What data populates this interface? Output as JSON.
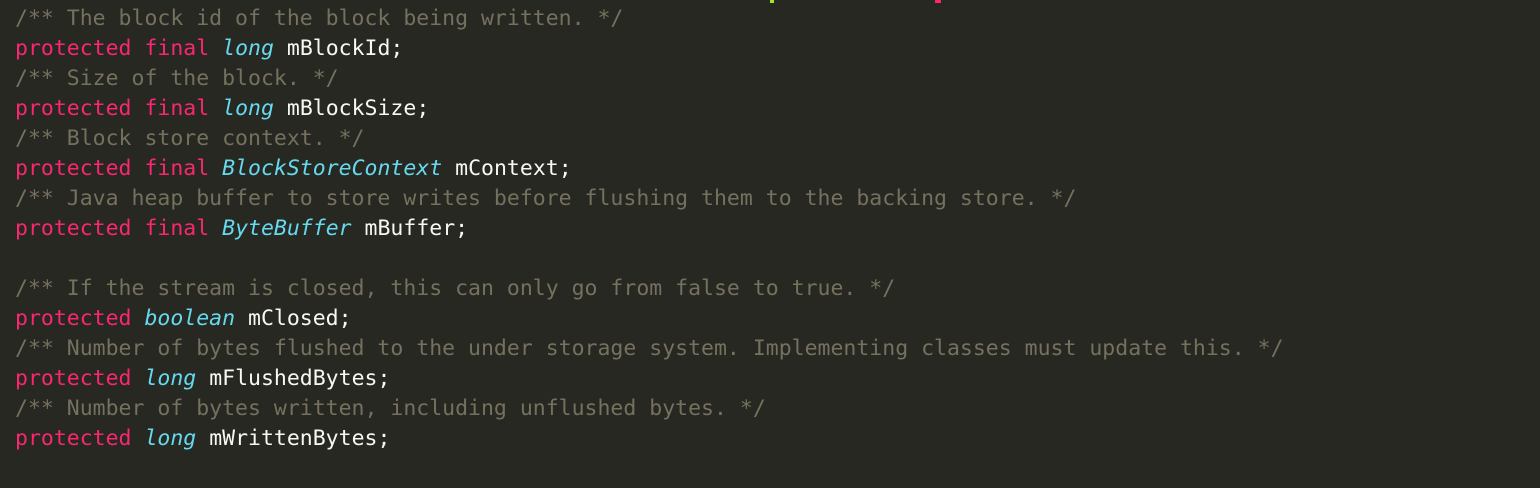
{
  "editor": {
    "lines": [
      [
        {
          "k": "comment",
          "t": "/** The block id of the block being written. */"
        }
      ],
      [
        {
          "k": "kw",
          "t": "protected"
        },
        {
          "k": "sp",
          "t": " "
        },
        {
          "k": "kw",
          "t": "final"
        },
        {
          "k": "sp",
          "t": " "
        },
        {
          "k": "type",
          "t": "long"
        },
        {
          "k": "sp",
          "t": " "
        },
        {
          "k": "ident",
          "t": "mBlockId;"
        }
      ],
      [
        {
          "k": "comment",
          "t": "/** Size of the block. */"
        }
      ],
      [
        {
          "k": "kw",
          "t": "protected"
        },
        {
          "k": "sp",
          "t": " "
        },
        {
          "k": "kw",
          "t": "final"
        },
        {
          "k": "sp",
          "t": " "
        },
        {
          "k": "type",
          "t": "long"
        },
        {
          "k": "sp",
          "t": " "
        },
        {
          "k": "ident",
          "t": "mBlockSize;"
        }
      ],
      [
        {
          "k": "comment",
          "t": "/** Block store context. */"
        }
      ],
      [
        {
          "k": "kw",
          "t": "protected"
        },
        {
          "k": "sp",
          "t": " "
        },
        {
          "k": "kw",
          "t": "final"
        },
        {
          "k": "sp",
          "t": " "
        },
        {
          "k": "type",
          "t": "BlockStoreContext"
        },
        {
          "k": "sp",
          "t": " "
        },
        {
          "k": "ident",
          "t": "mContext;"
        }
      ],
      [
        {
          "k": "comment",
          "t": "/** Java heap buffer to store writes before flushing them to the backing store. */"
        }
      ],
      [
        {
          "k": "kw",
          "t": "protected"
        },
        {
          "k": "sp",
          "t": " "
        },
        {
          "k": "kw",
          "t": "final"
        },
        {
          "k": "sp",
          "t": " "
        },
        {
          "k": "type",
          "t": "ByteBuffer"
        },
        {
          "k": "sp",
          "t": " "
        },
        {
          "k": "ident",
          "t": "mBuffer;"
        }
      ],
      [],
      [
        {
          "k": "comment",
          "t": "/** If the stream is closed, this can only go from false to true. */"
        }
      ],
      [
        {
          "k": "kw",
          "t": "protected"
        },
        {
          "k": "sp",
          "t": " "
        },
        {
          "k": "type",
          "t": "boolean"
        },
        {
          "k": "sp",
          "t": " "
        },
        {
          "k": "ident",
          "t": "mClosed;"
        }
      ],
      [
        {
          "k": "comment",
          "t": "/** Number of bytes flushed to the under storage system. Implementing classes must update this. */"
        }
      ],
      [
        {
          "k": "kw",
          "t": "protected"
        },
        {
          "k": "sp",
          "t": " "
        },
        {
          "k": "type",
          "t": "long"
        },
        {
          "k": "sp",
          "t": " "
        },
        {
          "k": "ident",
          "t": "mFlushedBytes;"
        }
      ],
      [
        {
          "k": "comment",
          "t": "/** Number of bytes written, including unflushed bytes. */"
        }
      ],
      [
        {
          "k": "kw",
          "t": "protected"
        },
        {
          "k": "sp",
          "t": " "
        },
        {
          "k": "type",
          "t": "long"
        },
        {
          "k": "sp",
          "t": " "
        },
        {
          "k": "ident",
          "t": "mWrittenBytes;"
        }
      ]
    ]
  },
  "colors": {
    "background": "#272822",
    "comment": "#75715e",
    "keyword": "#f92672",
    "type": "#66d9ef",
    "identifier": "#f8f8f2",
    "top_marker_green": "#a6e22e",
    "top_marker_pink": "#f92672"
  }
}
